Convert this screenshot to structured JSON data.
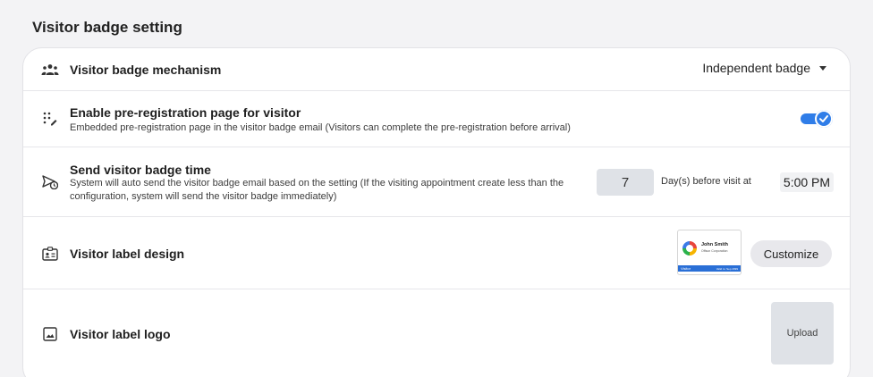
{
  "page": {
    "title": "Visitor badge setting"
  },
  "rows": {
    "mechanism": {
      "icon": "people-group-icon",
      "title": "Visitor badge mechanism",
      "selected_value": "Independent badge"
    },
    "pre_registration": {
      "icon": "dots-edit-icon",
      "title": "Enable pre-registration page for visitor",
      "description": "Embedded pre-registration page in the visitor badge email (Visitors can complete the pre-registration before arrival)",
      "enabled": true
    },
    "send_time": {
      "icon": "send-clock-icon",
      "title": "Send visitor badge time",
      "description": "System will auto send the visitor badge email based on the setting (If the visiting appointment create less than the configuration, system will send the visitor badge immediately)",
      "days_value": "7",
      "days_label": "Day(s) before visit at",
      "time_value": "5:00 PM"
    },
    "label_design": {
      "icon": "id-badge-icon",
      "title": "Visitor label design",
      "preview": {
        "name": "John Smith",
        "company": "Offsun Corporation",
        "bar_label": "Visitor",
        "bar_date": "Valid to: Sep 2099"
      },
      "button_label": "Customize"
    },
    "label_logo": {
      "icon": "image-icon",
      "title": "Visitor label logo",
      "button_label": "Upload"
    }
  },
  "colors": {
    "accent": "#2f7de8",
    "background": "#f3f3f5",
    "input_bg": "#dfe2e7"
  }
}
